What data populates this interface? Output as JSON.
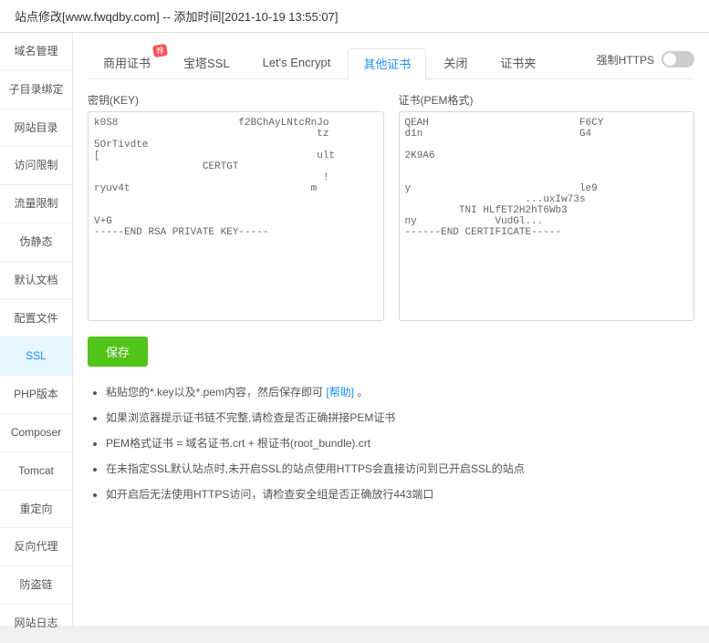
{
  "titleBar": {
    "text": "站点修改[www.fwqdby.com] -- 添加时间[2021-10-19 13:55:07]"
  },
  "sidebar": {
    "items": [
      {
        "id": "domain",
        "label": "域名管理",
        "active": false
      },
      {
        "id": "subdir",
        "label": "子目录绑定",
        "active": false
      },
      {
        "id": "webroot",
        "label": "网站目录",
        "active": false
      },
      {
        "id": "access",
        "label": "访问限制",
        "active": false
      },
      {
        "id": "traffic",
        "label": "流量限制",
        "active": false
      },
      {
        "id": "static",
        "label": "伪静态",
        "active": false
      },
      {
        "id": "default",
        "label": "默认文档",
        "active": false
      },
      {
        "id": "config",
        "label": "配置文件",
        "active": false
      },
      {
        "id": "ssl",
        "label": "SSL",
        "active": true
      },
      {
        "id": "php",
        "label": "PHP版本",
        "active": false
      },
      {
        "id": "composer",
        "label": "Composer",
        "active": false
      },
      {
        "id": "tomcat",
        "label": "Tomcat",
        "active": false
      },
      {
        "id": "redirect",
        "label": "重定向",
        "active": false
      },
      {
        "id": "proxy",
        "label": "反向代理",
        "active": false
      },
      {
        "id": "hotlink",
        "label": "防盗链",
        "active": false
      },
      {
        "id": "logs",
        "label": "网站日志",
        "active": false
      }
    ]
  },
  "tabs": [
    {
      "id": "commercial",
      "label": "商用证书",
      "badge": "荐",
      "active": false
    },
    {
      "id": "baota",
      "label": "宝塔SSL",
      "active": false
    },
    {
      "id": "letsencrypt",
      "label": "Let's Encrypt",
      "active": false
    },
    {
      "id": "other",
      "label": "其他证书",
      "active": true
    },
    {
      "id": "close",
      "label": "关闭",
      "active": false
    },
    {
      "id": "certfile",
      "label": "证书夹",
      "active": false
    }
  ],
  "forceHttps": {
    "label": "强制HTTPS"
  },
  "keySection": {
    "label": "密钥(KEY)",
    "startLine": "k0S8",
    "endLine": "f2BChAyLNtcRnJo",
    "secondLine": "5OrTivdte",
    "thirdPartial": "ult",
    "fourthLine": "CERTGT",
    "sixthLine": "ryuv4t",
    "seventhLine": "m",
    "lastLine": "V+G",
    "endCert": "-----END RSA PRIVATE KEY-----"
  },
  "certSection": {
    "label": "证书(PEM格式)",
    "startLine": "QEAH",
    "endPart": "F6CY",
    "line2a": "d1n",
    "line3": "2K9A6",
    "line7": "y",
    "line7end": "le9",
    "line8partial": "...uxIw73s",
    "line9": "TNI HLfET2H2hT6Wb3",
    "line10start": "ny",
    "line10end": "VudGl...",
    "endCert": "------END CERTIFICATE-----"
  },
  "saveButton": {
    "label": "保存"
  },
  "hints": [
    {
      "text": "粘贴您的*.key以及*.pem内容，然后保存即可",
      "link": "[帮助]",
      "linkAfter": "。"
    },
    {
      "text": "如果浏览器提示证书链不完整,请检查是否正确拼接PEM证书"
    },
    {
      "text": "PEM格式证书 = 域名证书.crt + 根证书(root_bundle).crt"
    },
    {
      "text": "在未指定SSL默认站点时,未开启SSL的站点使用HTTPS会直接访问到已开启SSL的站点"
    },
    {
      "text": "如开启后无法使用HTTPS访问，请检查安全组是否正确放行443端口"
    }
  ]
}
